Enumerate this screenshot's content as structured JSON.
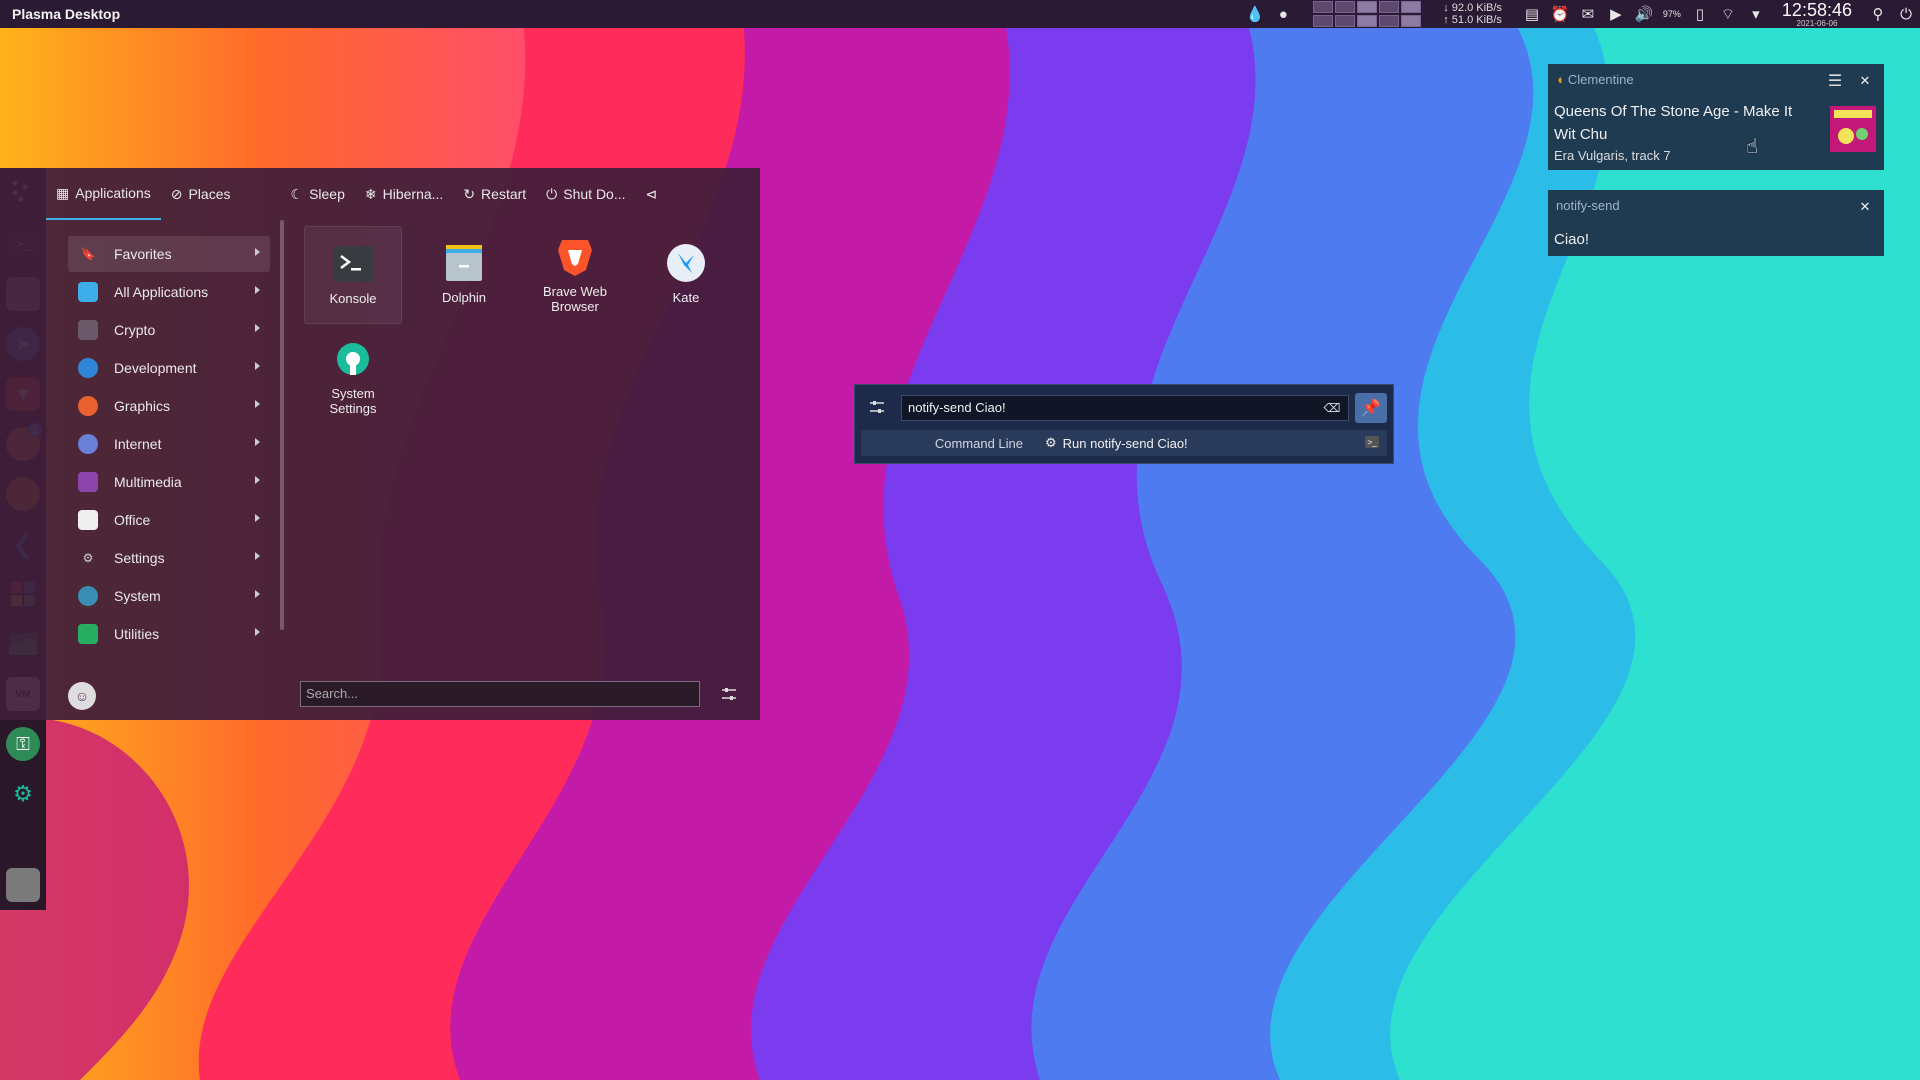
{
  "panel": {
    "title": "Plasma Desktop",
    "net_down": "92.0 KiB/s",
    "net_up": "51.0 KiB/s",
    "battery": "97%",
    "time": "12:58:46",
    "date": "2021-06-06"
  },
  "dock": {
    "badge_count": "1"
  },
  "menu": {
    "tabs": [
      "Applications",
      "Places"
    ],
    "power": [
      "Sleep",
      "Hiberna...",
      "Restart",
      "Shut Do..."
    ],
    "categories": [
      {
        "label": "Favorites",
        "color": "#e8e8e8"
      },
      {
        "label": "All Applications",
        "color": "#3daee9"
      },
      {
        "label": "Crypto",
        "color": "#9a8a9a"
      },
      {
        "label": "Development",
        "color": "#2f86d6"
      },
      {
        "label": "Graphics",
        "color": "#e8612e"
      },
      {
        "label": "Internet",
        "color": "#6a7fd6"
      },
      {
        "label": "Multimedia",
        "color": "#8e44ad"
      },
      {
        "label": "Office",
        "color": "#eeeeee"
      },
      {
        "label": "Settings",
        "color": "#cccccc"
      },
      {
        "label": "System",
        "color": "#3b8eb3"
      },
      {
        "label": "Utilities",
        "color": "#27ae60"
      }
    ],
    "apps": [
      "Konsole",
      "Dolphin",
      "Brave Web Browser",
      "Kate",
      "System Settings"
    ],
    "search_placeholder": "Search..."
  },
  "krunner": {
    "query": "notify-send Ciao!",
    "result_category": "Command Line",
    "result_text": "Run notify-send Ciao!"
  },
  "notifications": [
    {
      "app": "Clementine",
      "summary": "Queens Of The Stone Age - Make It Wit Chu",
      "body": "Era Vulgaris, track 7"
    },
    {
      "app": "notify-send",
      "summary": "Ciao!"
    }
  ]
}
